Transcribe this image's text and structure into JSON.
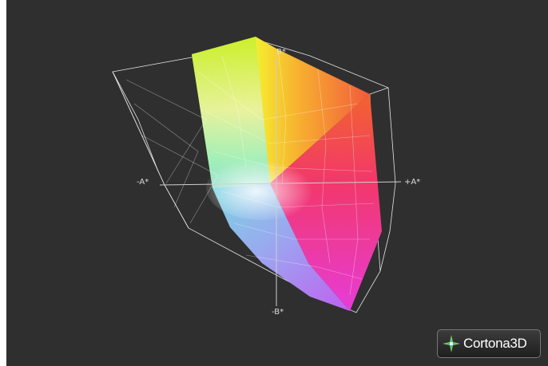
{
  "viewer": {
    "axis_labels": {
      "b_plus": "B*",
      "a_minus": "-A*",
      "a_plus": "+A*",
      "b_minus": "-B*"
    },
    "brand": {
      "name_main": "Cortona",
      "name_suffix": "3D",
      "logo_icon": "star-icon"
    }
  },
  "colors": {
    "background": "#2f2f2f",
    "wireframe": "#e6e6e6",
    "axis": "#cfcfcf"
  }
}
